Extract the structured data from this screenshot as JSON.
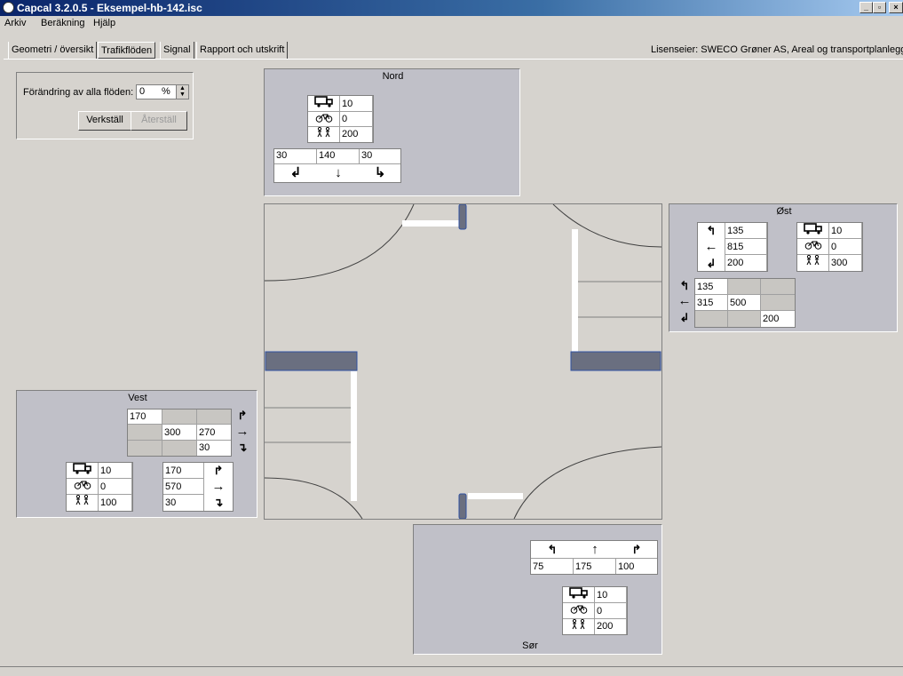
{
  "window": {
    "title": "Capcal 3.2.0.5 - Eksempel-hb-142.isc",
    "min": "_",
    "max": "▫",
    "close": "×"
  },
  "menu": [
    "Arkiv",
    "Beräkning",
    "Hjälp"
  ],
  "tabs": [
    "Geometri / översikt",
    "Trafikflöden",
    "Signal",
    "Rapport och utskrift"
  ],
  "license": "Lisenseier: SWECO Grøner AS, Areal og transportplanlegging",
  "change_panel": {
    "label": "Förändring av alla flöden:",
    "value": "0",
    "unit": "%",
    "apply": "Verkställ",
    "reset": "Återställ"
  },
  "nord": {
    "title": "Nord",
    "truck": "10",
    "bike": "0",
    "ped": "200",
    "turns": [
      "30",
      "140",
      "30"
    ]
  },
  "ost": {
    "title": "Øst",
    "turns": [
      "135",
      "815",
      "200"
    ],
    "truck": "10",
    "bike": "0",
    "ped": "300",
    "matrix": [
      [
        "135",
        "",
        ""
      ],
      [
        "315",
        "500",
        ""
      ],
      [
        "",
        "",
        "200"
      ]
    ]
  },
  "vest": {
    "title": "Vest",
    "matrix": [
      [
        "170",
        "",
        ""
      ],
      [
        "",
        "300",
        "270"
      ],
      [
        "",
        "",
        "30"
      ]
    ],
    "truck": "10",
    "bike": "0",
    "ped": "100",
    "turns": [
      "170",
      "570",
      "30"
    ]
  },
  "sor": {
    "title": "Sør",
    "turns": [
      "75",
      "175",
      "100"
    ],
    "truck": "10",
    "bike": "0",
    "ped": "200"
  },
  "icons": {
    "truck": "truck-icon",
    "bike": "bicycle-icon",
    "ped": "pedestrians-icon"
  }
}
